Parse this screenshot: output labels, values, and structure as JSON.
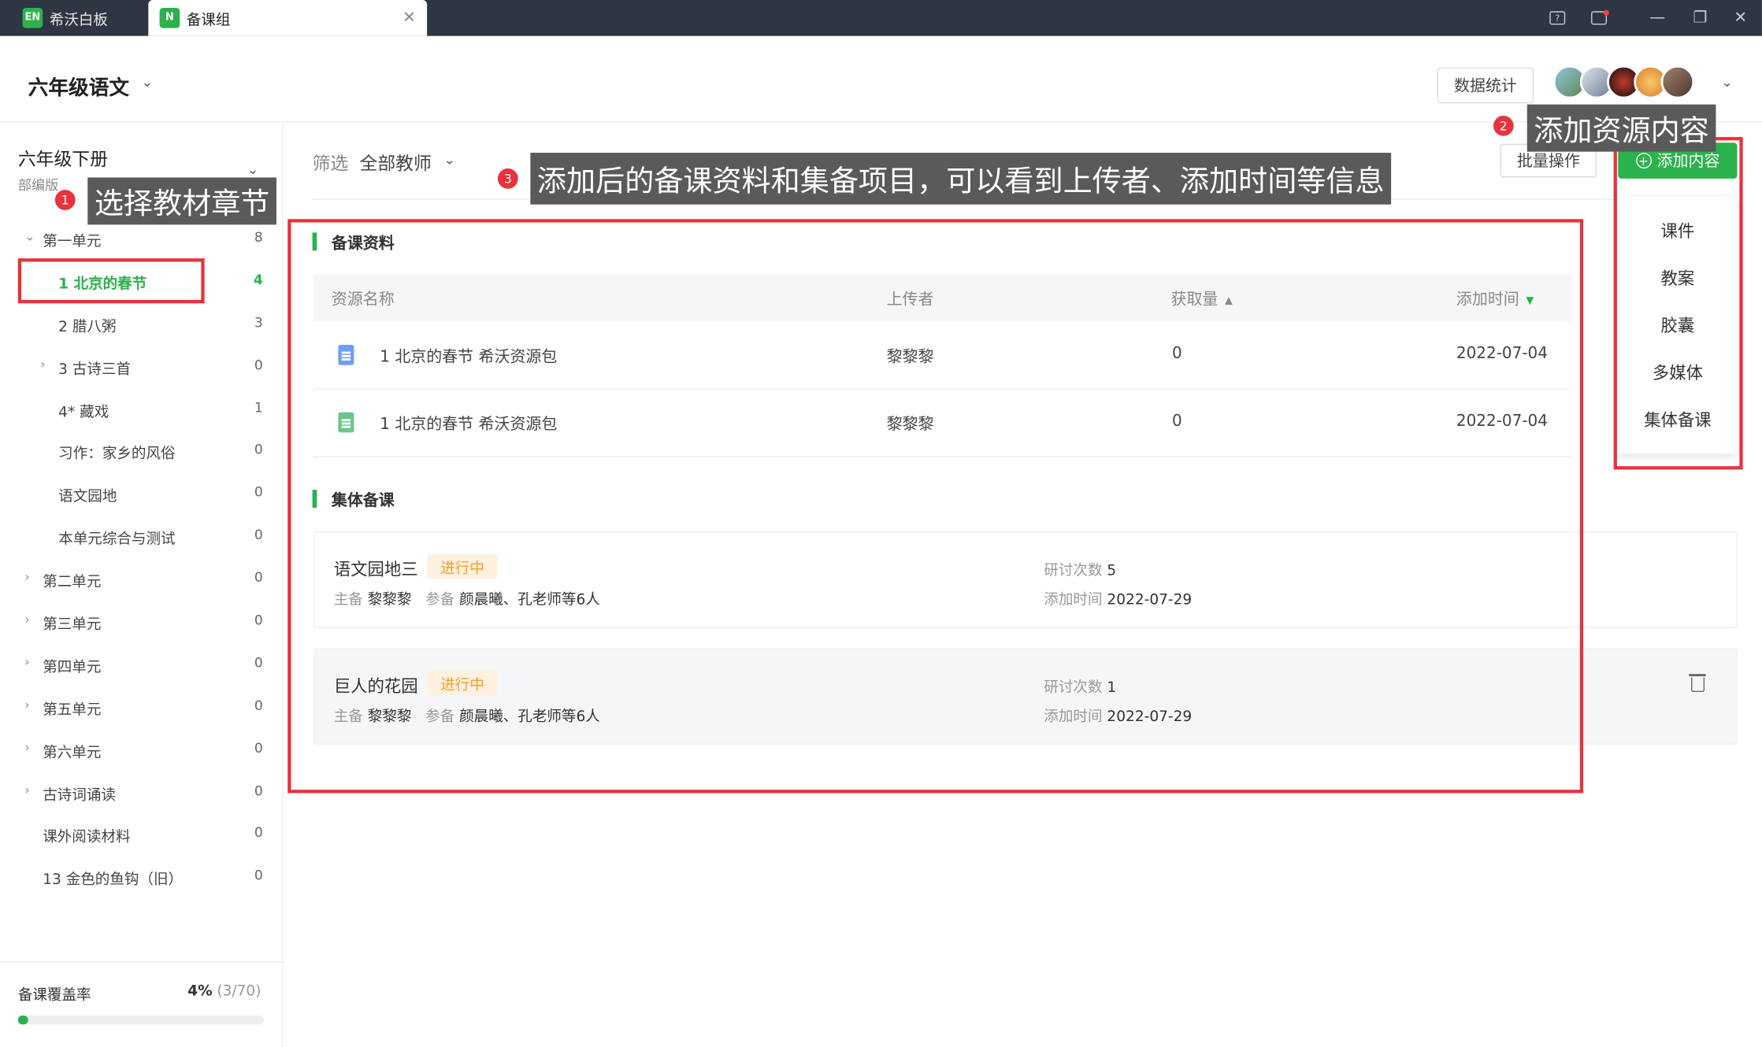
{
  "tabs": [
    {
      "logo": "EN",
      "label": "希沃白板"
    },
    {
      "logo": "N",
      "label": "备课组"
    }
  ],
  "header": {
    "title": "六年级语文",
    "stats_button": "数据统计"
  },
  "sidebar": {
    "book_title": "六年级下册",
    "book_edition": "部编版",
    "items": [
      {
        "label": "第一单元",
        "count": "8",
        "level": 0,
        "arrow": "down"
      },
      {
        "label": "1 北京的春节",
        "count": "4",
        "level": 1,
        "active": true
      },
      {
        "label": "2 腊八粥",
        "count": "3",
        "level": 1
      },
      {
        "label": "3 古诗三首",
        "count": "0",
        "level": 1,
        "arrow": "right"
      },
      {
        "label": "4* 藏戏",
        "count": "1",
        "level": 1
      },
      {
        "label": "习作：家乡的风俗",
        "count": "0",
        "level": 1
      },
      {
        "label": "语文园地",
        "count": "0",
        "level": 1
      },
      {
        "label": "本单元综合与测试",
        "count": "0",
        "level": 1
      },
      {
        "label": "第二单元",
        "count": "0",
        "level": 0,
        "arrow": "right"
      },
      {
        "label": "第三单元",
        "count": "0",
        "level": 0,
        "arrow": "right"
      },
      {
        "label": "第四单元",
        "count": "0",
        "level": 0,
        "arrow": "right"
      },
      {
        "label": "第五单元",
        "count": "0",
        "level": 0,
        "arrow": "right"
      },
      {
        "label": "第六单元",
        "count": "0",
        "level": 0,
        "arrow": "right"
      },
      {
        "label": "古诗词诵读",
        "count": "0",
        "level": 0,
        "arrow": "right"
      },
      {
        "label": "课外阅读材料",
        "count": "0",
        "level": 0
      },
      {
        "label": "13 金色的鱼钩（旧）",
        "count": "0",
        "level": 0
      }
    ],
    "coverage": {
      "label": "备课覆盖率",
      "percent": "4%",
      "fraction": "(3/70)",
      "value": 0.04
    }
  },
  "main": {
    "filter_label": "筛选",
    "filter_value": "全部教师",
    "batch_button": "批量操作",
    "add_button": "添加内容",
    "resources": {
      "title": "备课资料",
      "columns": [
        "资源名称",
        "上传者",
        "获取量",
        "添加时间"
      ],
      "rows": [
        {
          "name": "1 北京的春节 希沃资源包",
          "uploader": "黎黎黎",
          "count": "0",
          "date": "2022-07-04",
          "icon": "courseware-icon"
        },
        {
          "name": "1 北京的春节 希沃资源包",
          "uploader": "黎黎黎",
          "count": "0",
          "date": "2022-07-04",
          "icon": "document-icon"
        }
      ]
    },
    "collective": {
      "title": "集体备课",
      "items": [
        {
          "name": "语文园地三",
          "status": "进行中",
          "lead_label": "主备",
          "lead": "黎黎黎",
          "members_label": "参备",
          "members": "颜晨曦、孔老师等6人",
          "sessions_label": "研讨次数",
          "sessions": "5",
          "date_label": "添加时间",
          "date": "2022-07-29"
        },
        {
          "name": "巨人的花园",
          "status": "进行中",
          "lead_label": "主备",
          "lead": "黎黎黎",
          "members_label": "参备",
          "members": "颜晨曦、孔老师等6人",
          "sessions_label": "研讨次数",
          "sessions": "1",
          "date_label": "添加时间",
          "date": "2022-07-29"
        }
      ]
    }
  },
  "add_menu": [
    "课件",
    "教案",
    "胶囊",
    "多媒体",
    "集体备课"
  ],
  "annotations": [
    {
      "num": "1",
      "text": "选择教材章节"
    },
    {
      "num": "2",
      "text": "添加资源内容"
    },
    {
      "num": "3",
      "text": "添加后的备课资料和集备项目，可以看到上传者、添加时间等信息"
    }
  ],
  "colors": {
    "accent": "#2bb24c",
    "titlebar": "#2f3542",
    "annotation_red": "#e8323c",
    "badge_text": "#f39c2b"
  }
}
